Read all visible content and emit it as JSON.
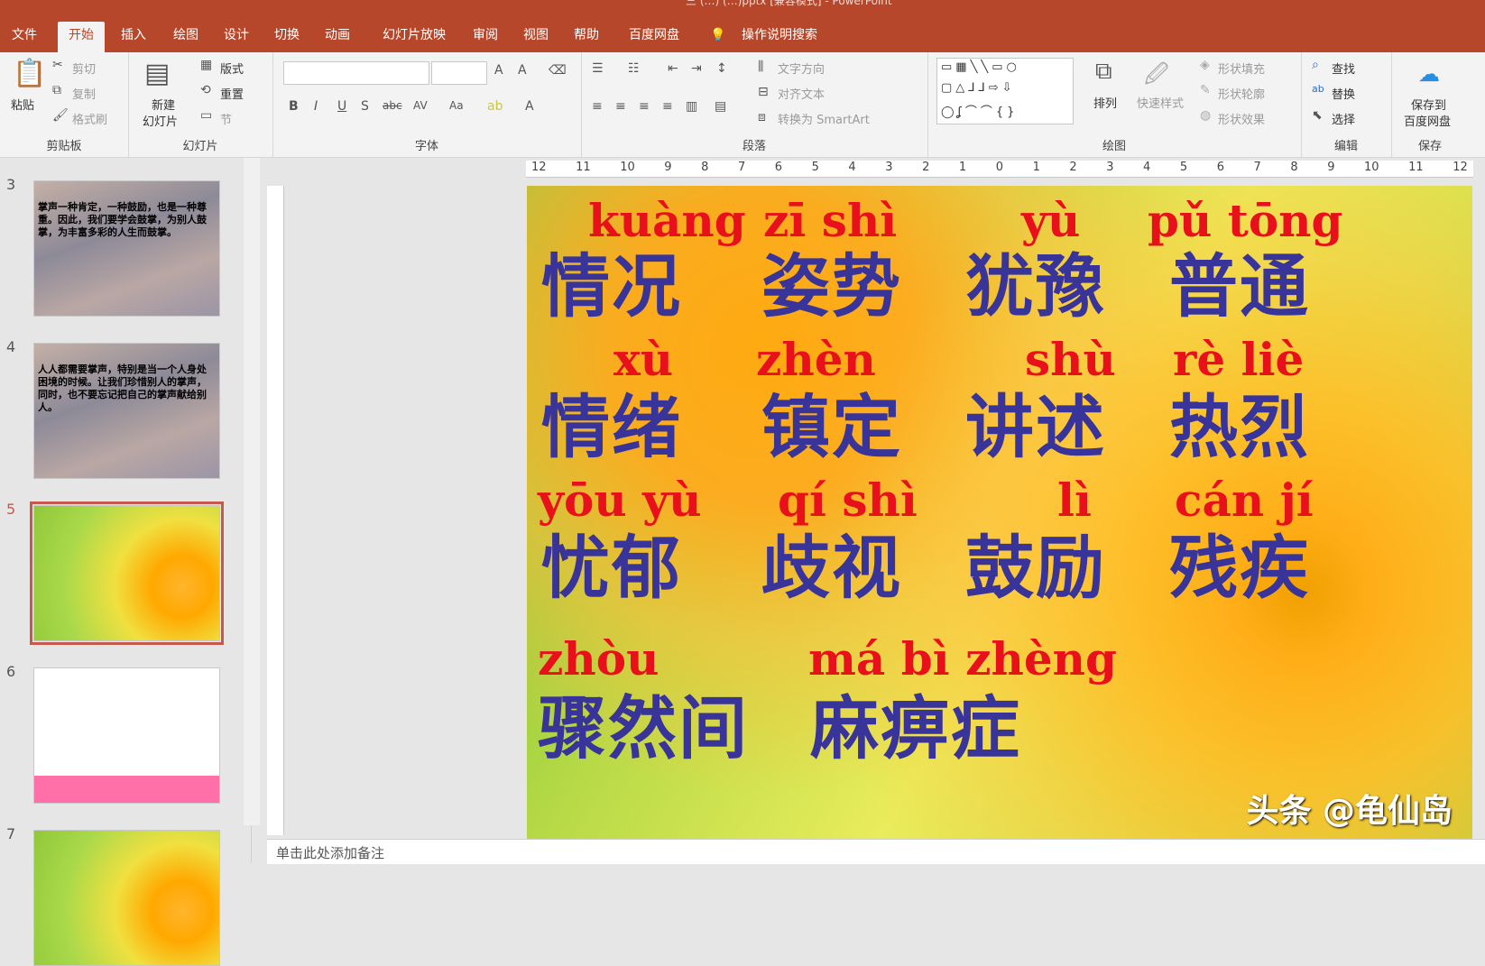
{
  "window": {
    "title": "三 (…) (…)pptx [兼容模式] - PowerPoint"
  },
  "tabs": [
    "文件",
    "开始",
    "插入",
    "绘图",
    "设计",
    "切换",
    "动画",
    "幻灯片放映",
    "审阅",
    "视图",
    "帮助",
    "百度网盘"
  ],
  "active_tab": "开始",
  "tell_me": "操作说明搜索",
  "ribbon": {
    "clipboard": {
      "paste": "粘贴",
      "cut": "剪切",
      "copy": "复制",
      "format_painter": "格式刷",
      "label": "剪贴板"
    },
    "slides": {
      "new_slide": "新建\n幻灯片",
      "new_slide_1": "新建",
      "new_slide_2": "幻灯片",
      "layout": "版式",
      "reset": "重置",
      "section": "节",
      "label": "幻灯片"
    },
    "font": {
      "label": "字体"
    },
    "paragraph": {
      "text_direction": "文字方向",
      "align_text": "对齐文本",
      "smartart": "转换为 SmartArt",
      "label": "段落"
    },
    "drawing": {
      "arrange": "排列",
      "quick_styles": "快速样式",
      "shape_fill": "形状填充",
      "shape_outline": "形状轮廓",
      "shape_effects": "形状效果",
      "label": "绘图"
    },
    "editing": {
      "find": "查找",
      "replace": "替换",
      "select": "选择",
      "label": "编辑"
    },
    "save": {
      "save_to_1": "保存到",
      "save_to_2": "百度网盘",
      "label": "保存"
    }
  },
  "ruler": [
    "12",
    "11",
    "10",
    "9",
    "8",
    "7",
    "6",
    "5",
    "4",
    "3",
    "2",
    "1",
    "0",
    "1",
    "2",
    "3",
    "4",
    "5",
    "6",
    "7",
    "8",
    "9",
    "10",
    "11",
    "12"
  ],
  "thumbnails": [
    {
      "num": "3",
      "text": "掌声一种肯定，一种鼓励，也是一种尊重。因此，我们要学会鼓掌，为别人鼓掌，为丰富多彩的人生而鼓掌。"
    },
    {
      "num": "4",
      "text": "人人都需要掌声，特别是当一个人身处困境的时候。让我们珍惜别人的掌声，同时，也不要忘记把自己的掌声献给别人。"
    },
    {
      "num": "5"
    },
    {
      "num": "6"
    },
    {
      "num": "7"
    }
  ],
  "slide": {
    "rows": [
      {
        "pinyin": [
          "kuàng",
          "zī  shì",
          "yù",
          "pǔ tōng"
        ],
        "hanzi": [
          "情况",
          "姿势",
          "犹豫",
          "普通"
        ]
      },
      {
        "pinyin": [
          "xù",
          "zhèn",
          "shù",
          "rè  liè"
        ],
        "hanzi": [
          "情绪",
          "镇定",
          "讲述",
          "热烈"
        ]
      },
      {
        "pinyin": [
          "yōu yù",
          "qí  shì",
          "lì",
          "cán jí"
        ],
        "hanzi": [
          "忧郁",
          "歧视",
          "鼓励",
          "残疾"
        ]
      },
      {
        "pinyin": [
          "zhòu",
          "má bì zhèng"
        ],
        "hanzi": [
          "骤然间",
          "麻痹症"
        ]
      }
    ],
    "watermark": "头条 @龟仙岛"
  },
  "notes_placeholder": "单击此处添加备注"
}
